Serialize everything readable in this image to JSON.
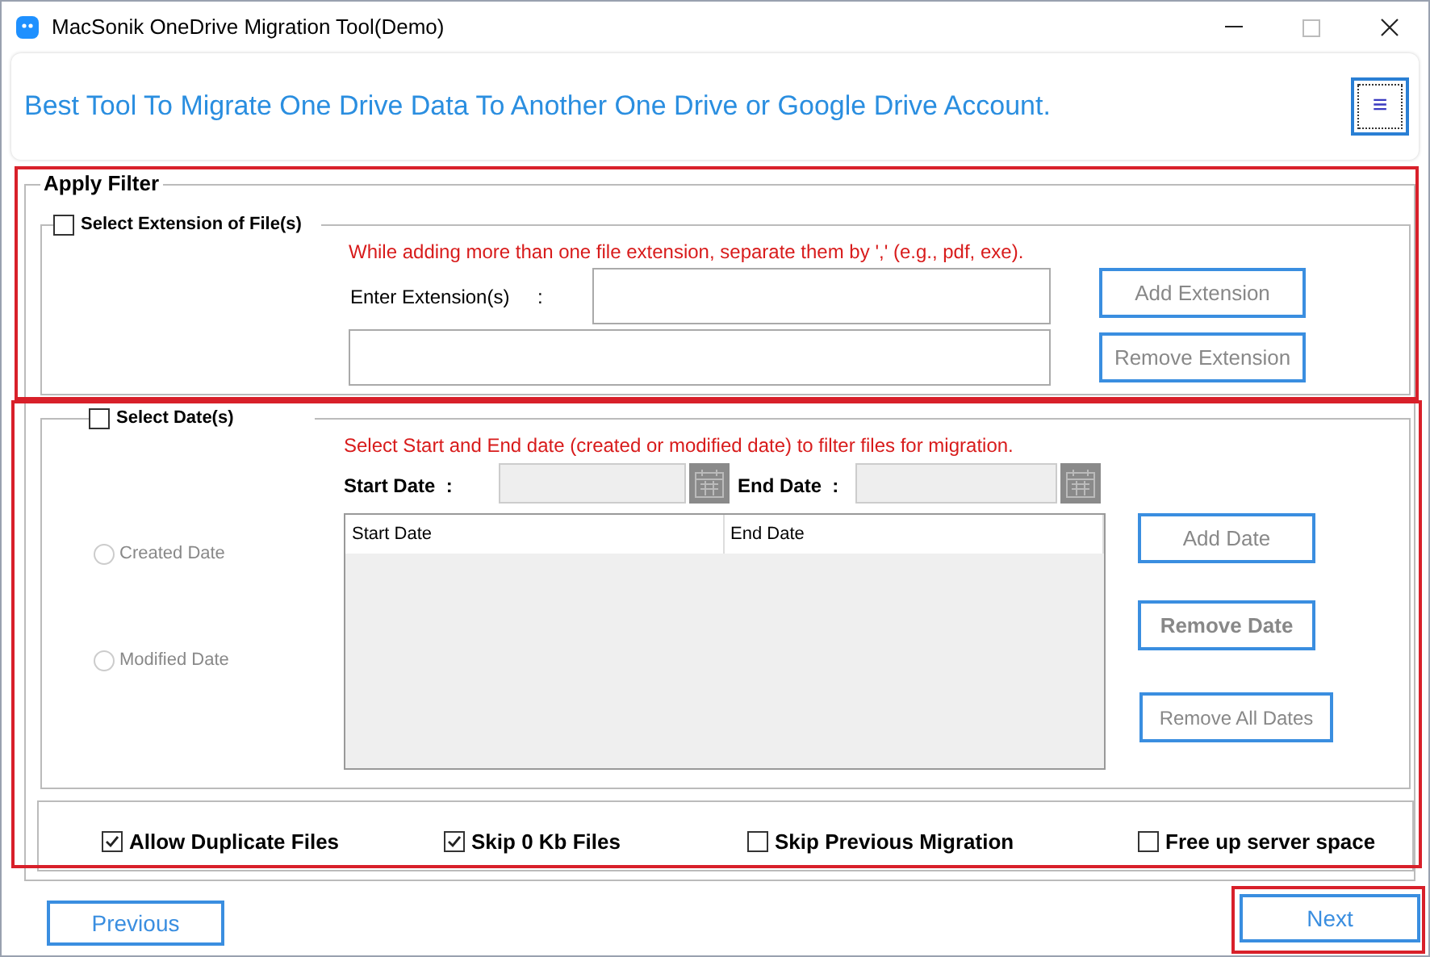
{
  "window": {
    "title": "MacSonik OneDrive Migration Tool(Demo)"
  },
  "header": {
    "headline": "Best Tool To Migrate One Drive Data To Another One Drive or Google Drive Account.",
    "menu_button": "≡"
  },
  "filter": {
    "legend": "Apply Filter",
    "extension": {
      "label": "Select Extension of File(s)",
      "checked": false,
      "hint": "While adding more than one file extension, separate them by ',' (e.g., pdf, exe).",
      "input_label": "Enter Extension(s)",
      "colon": ":",
      "buttons": [
        {
          "label": "Add Extension",
          "disabled": true
        },
        {
          "label": "Remove Extension",
          "disabled": true
        }
      ]
    },
    "dates": {
      "label": "Select Date(s)",
      "checked": false,
      "hint": "Select Start and End date (created or modified date) to filter files for migration.",
      "start_label": "Start Date  :",
      "end_label": "End Date  :",
      "radios": [
        {
          "label": "Created Date",
          "selected": false
        },
        {
          "label": "Modified Date",
          "selected": false
        }
      ],
      "columns": [
        "Start Date",
        "End Date"
      ],
      "buttons": [
        {
          "label": "Add Date",
          "disabled": true,
          "bold": false
        },
        {
          "label": "Remove Date",
          "disabled": true,
          "bold": true
        },
        {
          "label": "Remove All Dates",
          "disabled": true,
          "bold": false
        }
      ]
    },
    "options": [
      {
        "label": "Allow Duplicate Files",
        "checked": true
      },
      {
        "label": "Skip 0 Kb Files",
        "checked": true
      },
      {
        "label": "Skip Previous Migration",
        "checked": false
      },
      {
        "label": "Free up server space",
        "checked": false
      }
    ]
  },
  "footer": {
    "previous": "Previous",
    "next": "Next"
  }
}
